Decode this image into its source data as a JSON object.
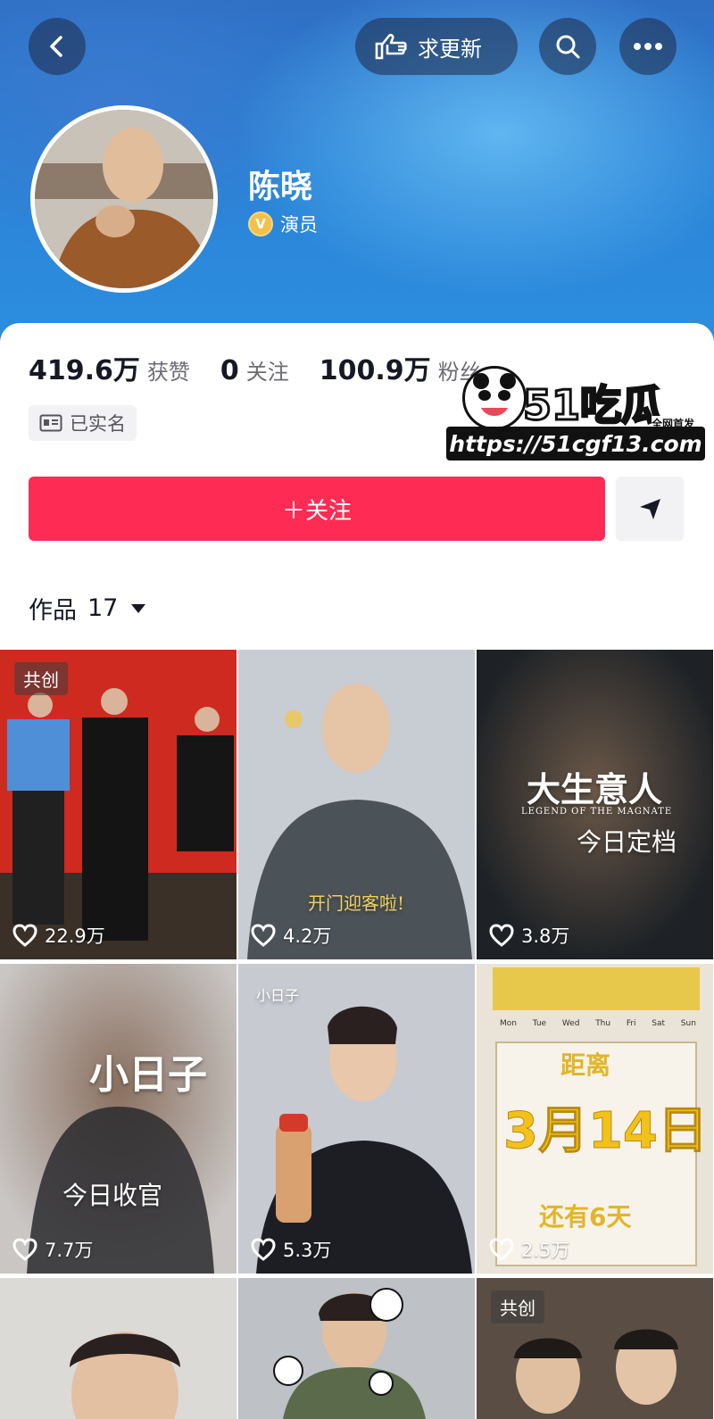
{
  "header": {
    "request_update_label": "求更新",
    "name": "陈晓",
    "verify_badge": "V",
    "role": "演员"
  },
  "stats": {
    "likes_value": "419.6万",
    "likes_label": "获赞",
    "following_value": "0",
    "following_label": "关注",
    "fans_value": "100.9万",
    "fans_label": "粉丝"
  },
  "realname_label": "已实名",
  "follow_button": "＋关注",
  "works_tab": {
    "label": "作品",
    "count": "17"
  },
  "videos": [
    {
      "badge": "共创",
      "likes": "22.9万",
      "overlay": ""
    },
    {
      "badge": "",
      "likes": "4.2万",
      "overlay": "开门迎客啦!"
    },
    {
      "badge": "",
      "likes": "3.8万",
      "overlay": "大生意人",
      "overlay2": "LEGEND OF THE MAGNATE",
      "overlay3": "今日定档"
    },
    {
      "badge": "",
      "likes": "7.7万",
      "overlay": "小日子",
      "overlay2": "今日收官"
    },
    {
      "badge": "",
      "likes": "5.3万",
      "overlay": "小日子"
    },
    {
      "badge": "",
      "likes": "2.5万",
      "overlay": "距离",
      "overlay2": "3月14日",
      "overlay3": "还有6天",
      "weekdays": [
        "Mon",
        "Tue",
        "Wed",
        "Thu",
        "Fri",
        "Sat",
        "Sun"
      ]
    },
    {
      "badge": "",
      "likes": ""
    },
    {
      "badge": "",
      "likes": ""
    },
    {
      "badge": "共创",
      "likes": ""
    }
  ],
  "watermark": {
    "title": "51吃瓜",
    "subtitle": "全网首发",
    "url": "https://51cgf13.com"
  },
  "colors": {
    "accent": "#fe2c55",
    "header": "#2d8fe0"
  }
}
